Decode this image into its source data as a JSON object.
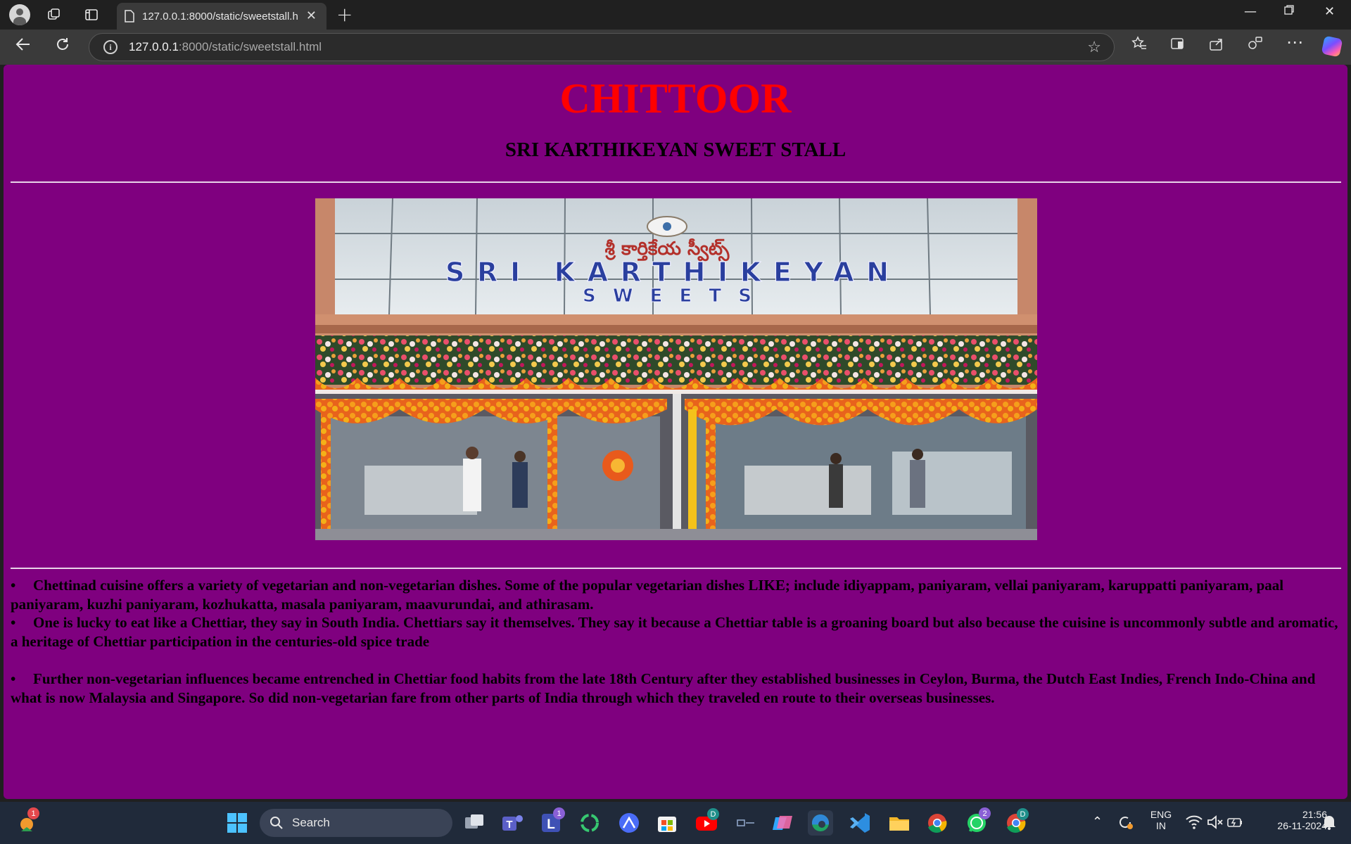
{
  "browser": {
    "tab_title": "127.0.0.1:8000/static/sweetstall.ht",
    "url_host": "127.0.0.1",
    "url_path": ":8000/static/sweetstall.html",
    "new_tab_label": "+",
    "tab_close_label": "✕"
  },
  "page": {
    "heading": "CHITTOOR",
    "subheading": "SRI KARTHIKEYAN SWEET STALL",
    "photo": {
      "sign_telugu": "శ్రీ కార్తికేయ స్వీట్స్",
      "sign_line1": "SRI KARTHIKEYAN",
      "sign_line2": "SWEETS"
    },
    "paragraphs": [
      "Chettinad cuisine offers a variety of vegetarian and non-vegetarian dishes. Some of the popular vegetarian dishes LIKE; include idiyappam, paniyaram, vellai paniyaram, karuppatti paniyaram, paal paniyaram, kuzhi paniyaram, kozhukatta, masala paniyaram, maavurundai, and athirasam.",
      "One is lucky to eat like a Chettiar, they say in South India. Chettiars say it themselves. They say it because a Chettiar table is a groaning board but also because the cuisine is uncommonly subtle and aromatic, a heritage of Chettiar participation in the centuries-old spice trade",
      "Further non-vegetarian influences became entrenched in Chettiar food habits from the late 18th Century after they established businesses in Ceylon, Burma, the Dutch East Indies, French Indo-China and what is now Malaysia and Singapore. So did non-vegetarian fare from other parts of India through which they traveled en route to their overseas businesses."
    ],
    "bullet": "•",
    "colors": {
      "background": "#800080",
      "heading": "#ff0000",
      "text": "#000000"
    }
  },
  "taskbar": {
    "search_label": "Search",
    "widget_badge": "1",
    "teams_l_badge": "1",
    "whatsapp_badge": "2",
    "youtube_badge": "D",
    "chrome_badge": "D",
    "lang_line1": "ENG",
    "lang_line2": "IN",
    "time": "21:56",
    "date": "26-11-2024"
  }
}
